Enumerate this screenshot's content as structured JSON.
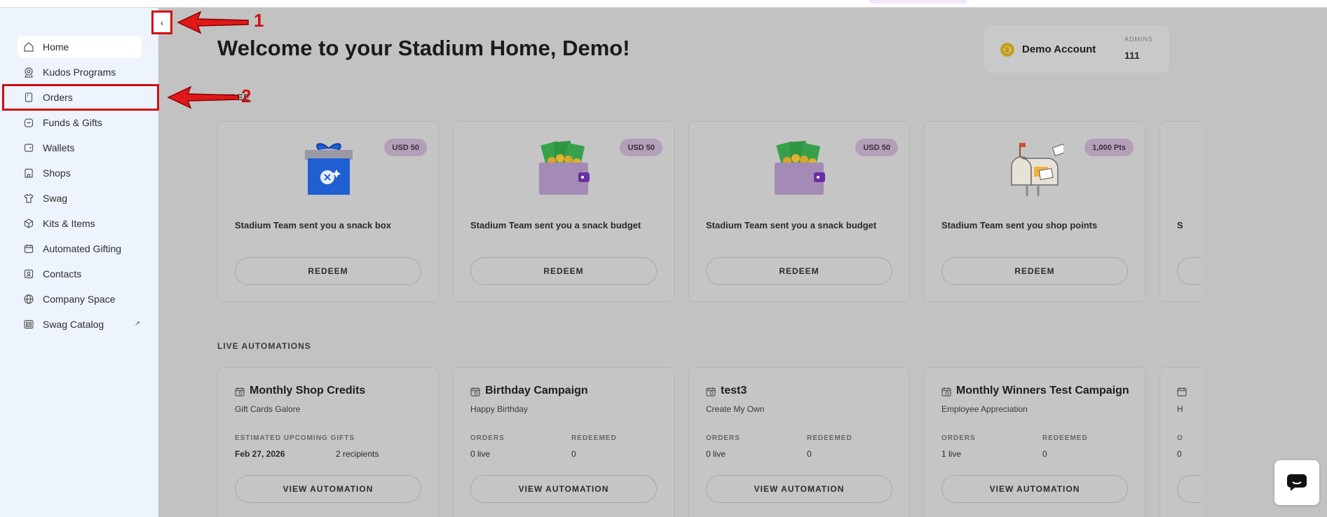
{
  "colors": {
    "accent_red": "#d10f0f",
    "sidebar_bg": "#eef4fe",
    "overlay_gray": "#c2c2c2",
    "badge_purple": "#b39fb7"
  },
  "sidebar": {
    "collapse_icon": "‹",
    "items": [
      {
        "label": "Home",
        "icon": "home-icon"
      },
      {
        "label": "Kudos Programs",
        "icon": "kudos-icon"
      },
      {
        "label": "Orders",
        "icon": "orders-icon"
      },
      {
        "label": "Funds & Gifts",
        "icon": "funds-icon"
      },
      {
        "label": "Wallets",
        "icon": "wallet-icon"
      },
      {
        "label": "Shops",
        "icon": "shop-icon"
      },
      {
        "label": "Swag",
        "icon": "shirt-icon"
      },
      {
        "label": "Kits & Items",
        "icon": "kits-icon"
      },
      {
        "label": "Automated Gifting",
        "icon": "calendar-icon"
      },
      {
        "label": "Contacts",
        "icon": "contacts-icon"
      },
      {
        "label": "Company Space",
        "icon": "globe-icon"
      },
      {
        "label": "Swag Catalog",
        "icon": "catalog-icon",
        "external_icon": "↗"
      }
    ]
  },
  "header": {
    "title": "Welcome to your Stadium Home, Demo!",
    "account_name": "Demo Account",
    "admins_label": "ADMINS",
    "admins_count": "111"
  },
  "redeem": {
    "section_label": "REDEEM",
    "cards": [
      {
        "badge": "USD 50",
        "text": "Stadium Team sent you a snack box",
        "button": "REDEEM",
        "illustration": "gift-box"
      },
      {
        "badge": "USD 50",
        "text": "Stadium Team sent you a snack budget",
        "button": "REDEEM",
        "illustration": "wallet-cash"
      },
      {
        "badge": "USD 50",
        "text": "Stadium Team sent you a snack budget",
        "button": "REDEEM",
        "illustration": "wallet-cash"
      },
      {
        "badge": "1,000 Pts",
        "text": "Stadium Team sent you shop points",
        "button": "REDEEM",
        "illustration": "mailbox"
      }
    ],
    "partial_card_text": "S"
  },
  "automations": {
    "section_label": "LIVE AUTOMATIONS",
    "cards": [
      {
        "title": "Monthly Shop Credits",
        "subtitle": "Gift Cards Galore",
        "label_a": "ESTIMATED UPCOMING GIFTS",
        "value_a": "Feb 27, 2026",
        "label_b": "",
        "value_b": "2 recipients",
        "button": "VIEW AUTOMATION"
      },
      {
        "title": "Birthday Campaign",
        "subtitle": "Happy Birthday",
        "label_a": "ORDERS",
        "value_a": "0 live",
        "label_b": "REDEEMED",
        "value_b": "0",
        "button": "VIEW AUTOMATION"
      },
      {
        "title": "test3",
        "subtitle": "Create My Own",
        "label_a": "ORDERS",
        "value_a": "0 live",
        "label_b": "REDEEMED",
        "value_b": "0",
        "button": "VIEW AUTOMATION"
      },
      {
        "title": "Monthly Winners Test Campaign",
        "subtitle": "Employee Appreciation",
        "label_a": "ORDERS",
        "value_a": "1 live",
        "label_b": "REDEEMED",
        "value_b": "0",
        "button": "VIEW AUTOMATION"
      }
    ],
    "partial": {
      "subtitle": "H",
      "label": "O",
      "value": "0"
    }
  },
  "annotations": {
    "one": "1",
    "two": "2"
  }
}
